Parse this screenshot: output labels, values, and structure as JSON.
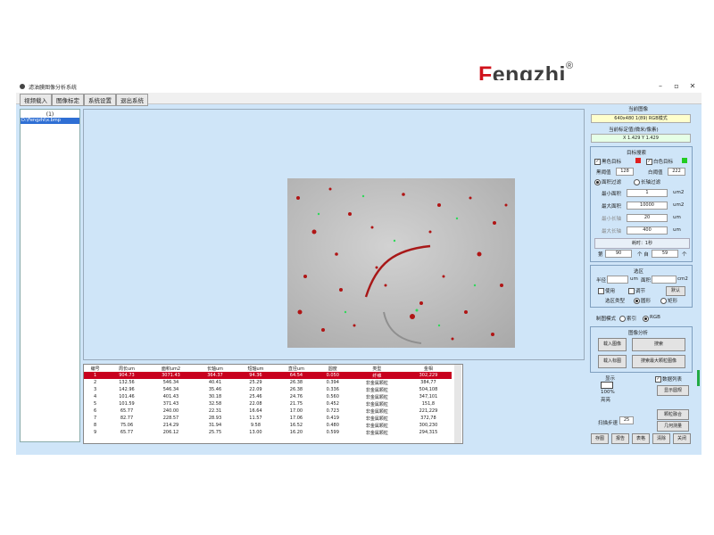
{
  "brand": {
    "logo_first": "F",
    "logo_rest": "engzhi",
    "registered": "®"
  },
  "window": {
    "title": "滤油膜图像分析系统",
    "minimize": "–",
    "restore": "▫",
    "close": "✕"
  },
  "menu": [
    "视频载入",
    "图像标定",
    "系统设置",
    "退出系统"
  ],
  "file_list": {
    "header": "(1)",
    "items": [
      "D:\\Fengzhi\\x.bmp"
    ]
  },
  "table": {
    "headers": [
      "编号",
      "周长um",
      "面积um2",
      "长轴um",
      "短轴um",
      "直径um",
      "圆度",
      "类型",
      "金相"
    ],
    "rows": [
      [
        "1",
        "904.73",
        "3071.43",
        "364.37",
        "94.36",
        "64.54",
        "0.050",
        "纤维",
        "302,229"
      ],
      [
        "2",
        "132.56",
        "546.34",
        "40.41",
        "25.29",
        "26.38",
        "0.394",
        "非金属颗粒",
        "384,77"
      ],
      [
        "3",
        "142.96",
        "546.34",
        "35.46",
        "22.09",
        "26.38",
        "0.336",
        "非金属颗粒",
        "504,108"
      ],
      [
        "4",
        "101.46",
        "401.43",
        "30.18",
        "25.46",
        "24.76",
        "0.560",
        "非金属颗粒",
        "347,101"
      ],
      [
        "5",
        "101.59",
        "371.43",
        "32.58",
        "22.08",
        "21.75",
        "0.452",
        "非金属颗粒",
        "151,8"
      ],
      [
        "6",
        "65.77",
        "240.00",
        "22.31",
        "16.64",
        "17.00",
        "0.723",
        "非金属颗粒",
        "221,229"
      ],
      [
        "7",
        "82.77",
        "228.57",
        "28.93",
        "11.57",
        "17.06",
        "0.419",
        "非金属颗粒",
        "372,78"
      ],
      [
        "8",
        "75.06",
        "214.29",
        "31.94",
        "9.58",
        "16.52",
        "0.480",
        "非金属颗粒",
        "300,230"
      ],
      [
        "9",
        "65.77",
        "206.12",
        "25.75",
        "13.00",
        "16.20",
        "0.599",
        "非金属颗粒",
        "294,315"
      ]
    ]
  },
  "right": {
    "current_image_label": "当前图像",
    "image_mode": "640x480 1(89) RGB模式",
    "calib_label": "当前标定值(微米/像素)",
    "calib_value": "X 1.429    Y 1.429",
    "target_search_title": "目标搜索",
    "black_target": "黑色目标",
    "white_target": "白色目标",
    "black_threshold_label": "黑阈值",
    "black_threshold": "128",
    "white_threshold_label": "白阈值",
    "white_threshold": "222",
    "area_filter": "面积过滤",
    "length_filter": "长轴过滤",
    "min_area_label": "最小面积",
    "min_area": "1",
    "max_area_label": "最大面积",
    "max_area": "10000",
    "min_len_label": "最小长轴",
    "min_len": "20",
    "max_len_label": "最大长轴",
    "max_len": "400",
    "unit_um2": "um2",
    "unit_um": "um",
    "elapsed": "耗时：1秒",
    "range_from_label": "第",
    "range_from": "90",
    "range_to_label": "个 自",
    "range_to": "59",
    "range_unit": "个",
    "roi_title": "选区",
    "radius_label": "半径",
    "radius_unit": "um",
    "roi_area_label": "面积",
    "roi_area_unit": "cm2",
    "use_label": "使用",
    "adjust_label": "调节",
    "default_btn": "默认",
    "roi_type_label": "选区类型",
    "circle_label": "圆形",
    "rect_label": "矩形",
    "draw_mode_label": "制图模式",
    "draw_mode_gray": "索引",
    "draw_mode_rgb": "RGB",
    "analysis_title": "图像分析",
    "load_image_btn": "载入图像",
    "search_btn": "搜索",
    "load_mark_btn": "载入标图",
    "search_max_btn": "搜索最大颗粒图像",
    "display_label": "显示",
    "zoom_label": "100%",
    "display_mode": "亮亮",
    "data_list_label": "数据列表",
    "show_circle_btn": "显示圆规",
    "scan_step_label": "扫描步速",
    "scan_step": "25",
    "particle_fuse_btn": "颗粒融合",
    "geo_measure_btn": "几何测量",
    "bottom_buttons": [
      "存图",
      "报告",
      "表格",
      "清除",
      "关闭"
    ]
  },
  "colors": {
    "accent_blue": "#2f6fd4",
    "selected_row": "#c8001e",
    "window_bg": "#cfe5f8"
  }
}
